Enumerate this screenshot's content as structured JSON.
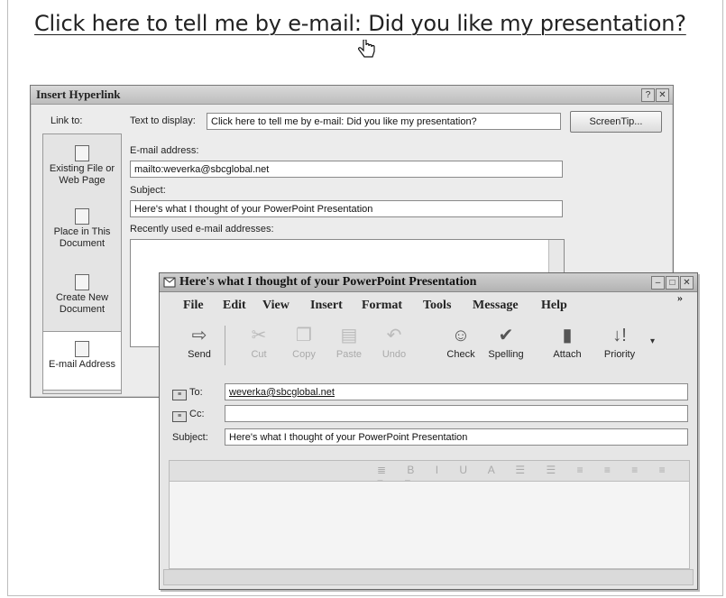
{
  "headline": "Click here to tell me by e-mail: Did you like my presentation?",
  "insert_hyperlink": {
    "title": "Insert Hyperlink",
    "link_to_label": "Link to:",
    "text_to_display_label": "Text to display:",
    "text_to_display_value": "Click here to tell me by e-mail: Did you like my presentation?",
    "screentip_label": "ScreenTip...",
    "email_label": "E-mail address:",
    "email_value": "mailto:weverka@sbcglobal.net",
    "subject_label": "Subject:",
    "subject_value": "Here's what I thought of your PowerPoint Presentation",
    "recent_label": "Recently used e-mail addresses:",
    "link_options": [
      {
        "line1": "Existing File or",
        "line2": "Web Page"
      },
      {
        "line1": "Place in This",
        "line2": "Document"
      },
      {
        "line1": "Create New",
        "line2": "Document"
      },
      {
        "line1": "E-mail Address",
        "line2": ""
      }
    ]
  },
  "message_window": {
    "title": "Here's what I thought of your PowerPoint Presentation",
    "menu": [
      "File",
      "Edit",
      "View",
      "Insert",
      "Format",
      "Tools",
      "Message",
      "Help"
    ],
    "toolbar": [
      {
        "label": "Send",
        "icon": "send-icon",
        "enabled": true
      },
      {
        "label": "Cut",
        "icon": "cut-icon",
        "enabled": false
      },
      {
        "label": "Copy",
        "icon": "copy-icon",
        "enabled": false
      },
      {
        "label": "Paste",
        "icon": "paste-icon",
        "enabled": false
      },
      {
        "label": "Undo",
        "icon": "undo-icon",
        "enabled": false
      },
      {
        "label": "Check",
        "icon": "check-names-icon",
        "enabled": true
      },
      {
        "label": "Spelling",
        "icon": "spelling-icon",
        "enabled": true
      },
      {
        "label": "Attach",
        "icon": "attach-icon",
        "enabled": true
      },
      {
        "label": "Priority",
        "icon": "priority-icon",
        "enabled": true
      }
    ],
    "to_label": "To:",
    "to_value": "weverka@sbcglobal.net",
    "cc_label": "Cc:",
    "cc_value": "",
    "subject_label": "Subject:",
    "subject_value": "Here's what I thought of your PowerPoint Presentation"
  }
}
